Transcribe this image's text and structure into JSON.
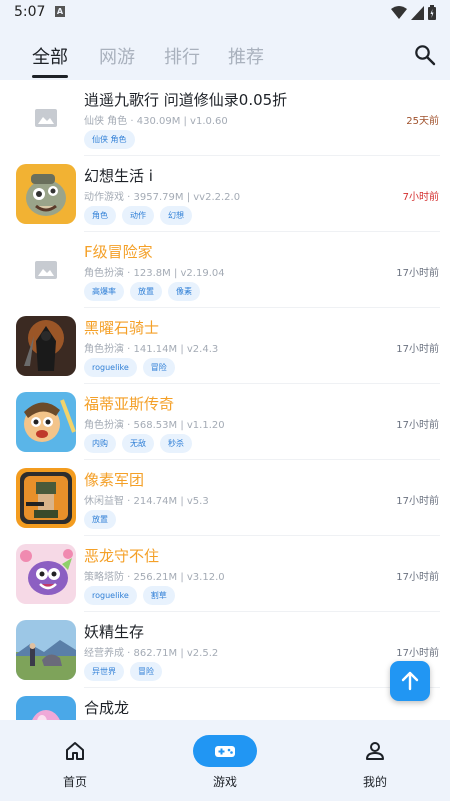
{
  "status": {
    "time": "5:07",
    "indicator": "A"
  },
  "tabs": [
    {
      "label": "全部"
    },
    {
      "label": "网游"
    },
    {
      "label": "排行"
    },
    {
      "label": "推荐"
    }
  ],
  "games": [
    {
      "name": "逍遥九歌行 问道修仙录0.05折",
      "meta": "仙侠 角色 · 430.09M | v1.0.60",
      "time": "25天前",
      "tags": [
        "仙侠 角色"
      ]
    },
    {
      "name": "幻想生活 i",
      "meta": "动作游戏 · 3957.79M | vv2.2.2.0",
      "time": "7小时前",
      "tags": [
        "角色",
        "动作",
        "幻想"
      ]
    },
    {
      "name": "F级冒险家",
      "meta": "角色扮演 · 123.8M | v2.19.04",
      "time": "17小时前",
      "tags": [
        "高爆率",
        "放置",
        "像素"
      ]
    },
    {
      "name": "黑曜石骑士",
      "meta": "角色扮演 · 141.14M | v2.4.3",
      "time": "17小时前",
      "tags": [
        "roguelike",
        "冒险"
      ]
    },
    {
      "name": "福蒂亚斯传奇",
      "meta": "角色扮演 · 568.53M | v1.1.20",
      "time": "17小时前",
      "tags": [
        "内购",
        "无敌",
        "秒杀"
      ]
    },
    {
      "name": "像素军团",
      "meta": "休闲益智 · 214.74M | v5.3",
      "time": "17小时前",
      "tags": [
        "放置"
      ]
    },
    {
      "name": "恶龙守不住",
      "meta": "策略塔防 · 256.21M | v3.12.0",
      "time": "17小时前",
      "tags": [
        "roguelike",
        "割草"
      ]
    },
    {
      "name": "妖精生存",
      "meta": "经营养成 · 862.71M | v2.5.2",
      "time": "17小时前",
      "tags": [
        "异世界",
        "冒险"
      ]
    },
    {
      "name": "合成龙",
      "meta": "",
      "time": "",
      "tags": []
    }
  ],
  "nav": [
    {
      "label": "首页",
      "icon": "home-icon"
    },
    {
      "label": "游戏",
      "icon": "gamepad-icon"
    },
    {
      "label": "我的",
      "icon": "person-icon"
    }
  ],
  "colors": {
    "accent": "#2196f3",
    "highlight_name": "#f4a028",
    "recent_time": "#d43030",
    "tag_bg": "#e8f2fd",
    "tag_text": "#2f7fd6"
  }
}
